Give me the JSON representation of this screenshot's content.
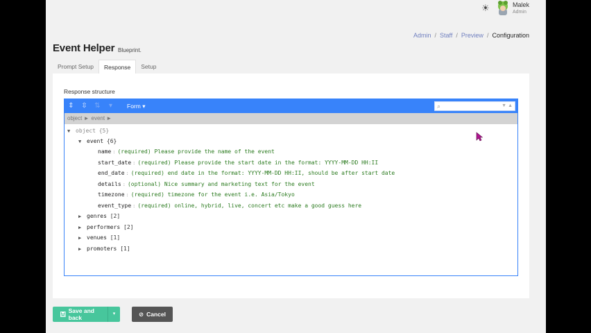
{
  "header": {
    "user_name": "Malek",
    "user_role": "Admin"
  },
  "breadcrumb": {
    "items": [
      "Admin",
      "Staff",
      "Preview"
    ],
    "current": "Configuration",
    "separator": "/"
  },
  "page": {
    "title": "Event Helper",
    "subtitle": "Blueprint."
  },
  "tabs": [
    {
      "label": "Prompt Setup",
      "active": false
    },
    {
      "label": "Response",
      "active": true
    },
    {
      "label": "Setup",
      "active": false
    }
  ],
  "response": {
    "label": "Response structure",
    "editor": {
      "mode_label": "Form ▾",
      "nav_path": [
        "object ►",
        "event ►"
      ],
      "root": {
        "key": "object",
        "count": "{5}"
      },
      "event": {
        "key": "event",
        "count": "{6}"
      },
      "fields": [
        {
          "key": "name",
          "value": "(required) Please provide the name of the event"
        },
        {
          "key": "start_date",
          "value": "(required) Please provide the start date in the format: YYYY-MM-DD HH:II"
        },
        {
          "key": "end_date",
          "value": "(required) end date in the format: YYYY-MM-DD HH:II, should be after start date"
        },
        {
          "key": "details",
          "value": "(optional) Nice summary and marketing text for the event"
        },
        {
          "key": "timezone",
          "value": "(required) timezone for the event i.e. Asia/Tokyo"
        },
        {
          "key": "event_type",
          "value": "(required) online, hybrid, live, concert etc make a good guess here"
        }
      ],
      "collections": [
        {
          "key": "genres",
          "count": "[2]"
        },
        {
          "key": "performers",
          "count": "[2]"
        },
        {
          "key": "venues",
          "count": "[1]"
        },
        {
          "key": "promoters",
          "count": "[1]"
        }
      ]
    }
  },
  "actions": {
    "save_label": "Save and back",
    "cancel_label": "Cancel"
  },
  "colors": {
    "editor_blue": "#3883fa",
    "save_green": "#47c69c",
    "cancel_gray": "#555555",
    "value_green": "#2a7a1e",
    "cursor_magenta": "#b0158f"
  }
}
